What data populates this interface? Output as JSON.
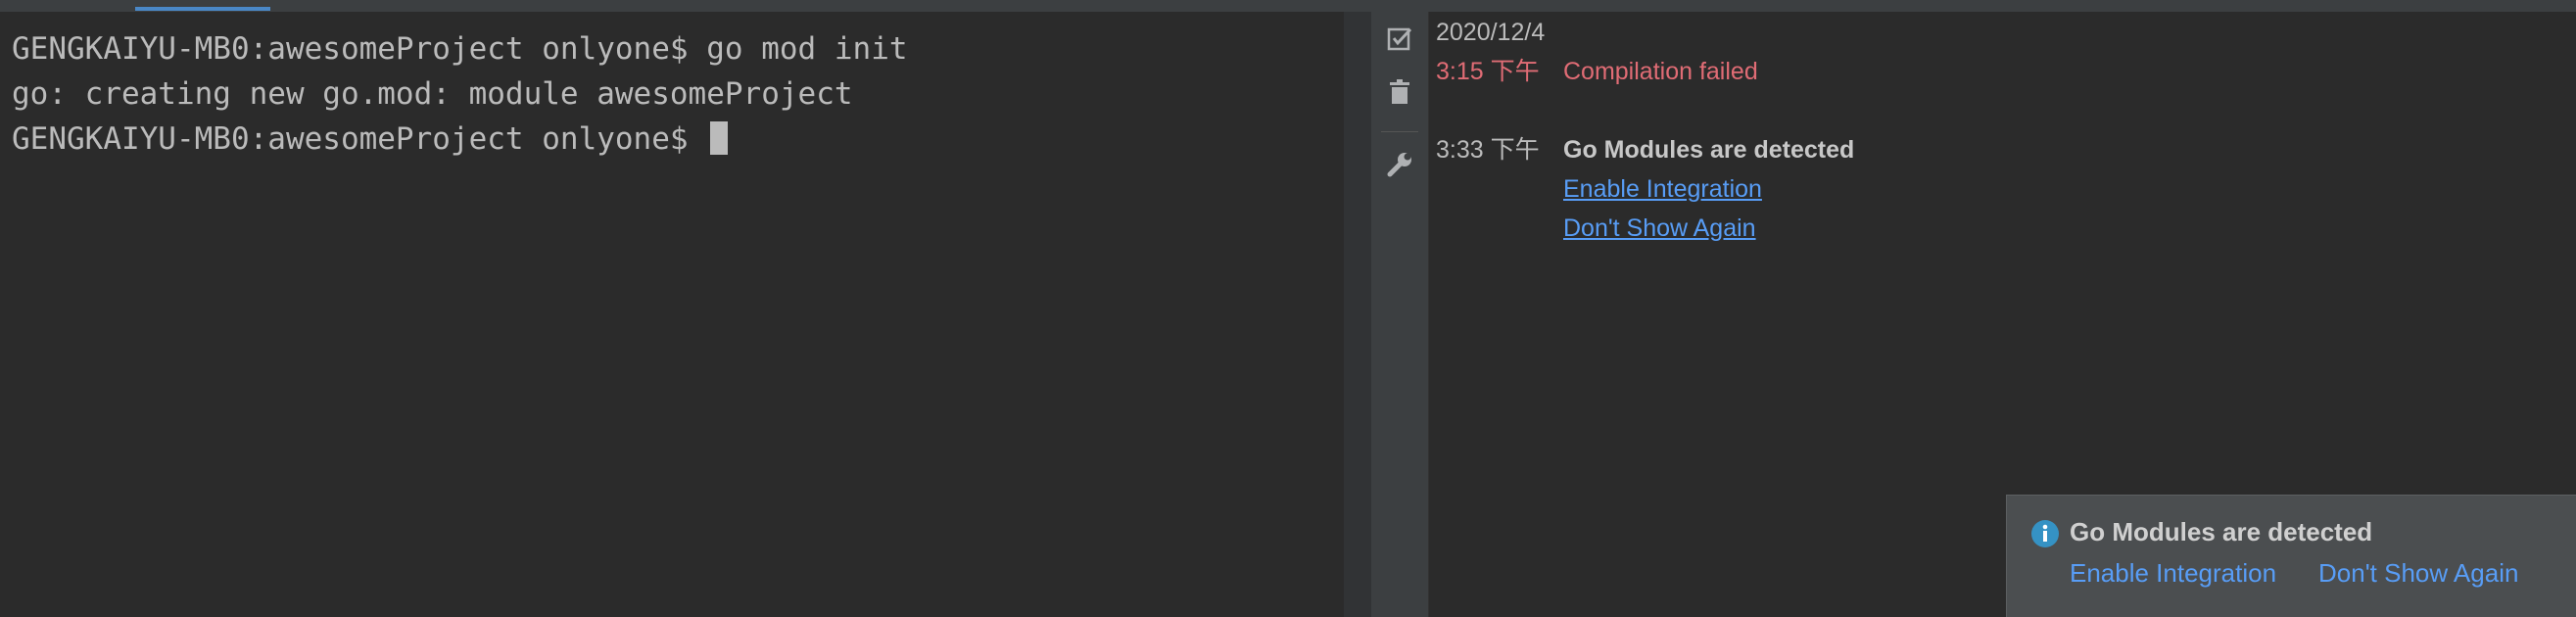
{
  "terminal": {
    "lines": [
      "GENGKAIYU-MB0:awesomeProject onlyone$ go mod init",
      "go: creating new go.mod: module awesomeProject",
      "GENGKAIYU-MB0:awesomeProject onlyone$ "
    ]
  },
  "toolbar": {
    "icons": [
      "mark-all-read-icon",
      "delete-icon",
      "settings-wrench-icon"
    ]
  },
  "event_log": {
    "date": "2020/12/4",
    "events": [
      {
        "time": "3:15 下午",
        "message": "Compilation failed",
        "status": "error"
      },
      {
        "time": "3:33 下午",
        "message": "Go Modules are detected",
        "actions": [
          "Enable Integration",
          "Don't Show Again"
        ]
      }
    ]
  },
  "notification": {
    "icon": "info-icon",
    "title": "Go Modules are detected",
    "actions": [
      "Enable Integration",
      "Don't Show Again"
    ]
  },
  "colors": {
    "background": "#2b2b2b",
    "error": "#e06c75",
    "link": "#589df6",
    "accent": "#4a88c7"
  }
}
